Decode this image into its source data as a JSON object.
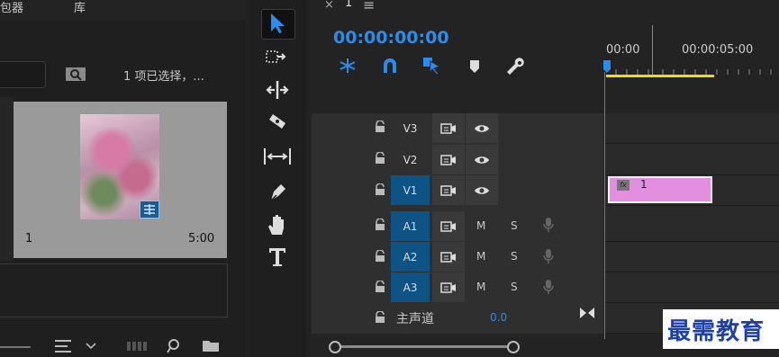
{
  "project_panel": {
    "tab_partial": "包器",
    "tab_library": "库",
    "selection_status": "1 项已选择，...",
    "clip": {
      "label": "1",
      "duration": "5:00"
    }
  },
  "sequence": {
    "tab_close": "×",
    "tab_name": "1",
    "tab_menu": "≡",
    "timecode": "00:00:00:00",
    "ruler": [
      "00:00",
      "00:00:05:00"
    ],
    "clip_label": "1",
    "clip_fx": "fx"
  },
  "tracks": {
    "video": [
      {
        "name": "V3"
      },
      {
        "name": "V2"
      },
      {
        "name": "V1"
      }
    ],
    "audio": [
      {
        "name": "A1",
        "m": "M",
        "s": "S"
      },
      {
        "name": "A2",
        "m": "M",
        "s": "S"
      },
      {
        "name": "A3",
        "m": "M",
        "s": "S"
      }
    ],
    "master": {
      "label": "主声道",
      "value": "0.0"
    }
  },
  "watermark": "最需教育",
  "colors": {
    "accent": "#2d8ceb",
    "clip": "#e28fe0",
    "work_area": "#f0e000",
    "target": "#0e5386"
  }
}
